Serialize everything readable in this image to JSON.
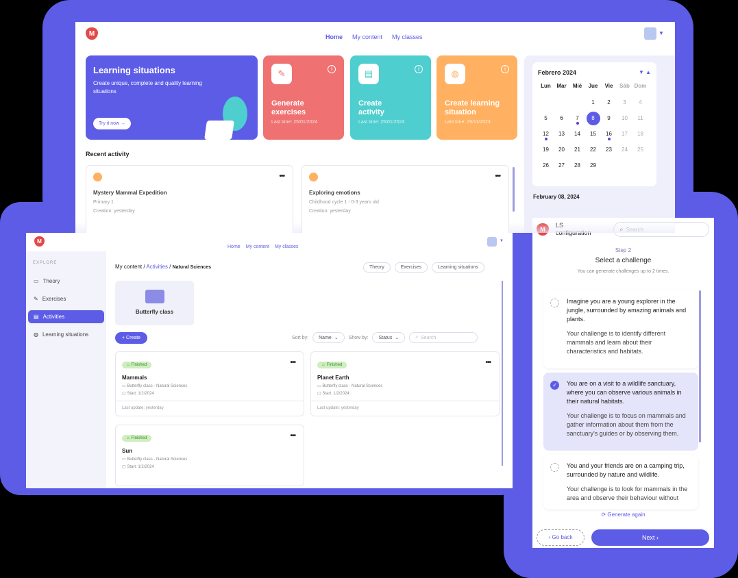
{
  "colors": {
    "accent": "#5d5ce6",
    "red": "#ef7171",
    "teal": "#4ecece",
    "orange": "#ffb060",
    "finished": "#cfeec0"
  },
  "home": {
    "nav": [
      "Home",
      "My content",
      "My classes"
    ],
    "hero": {
      "title": "Learning situations",
      "subtitle": "Create unique, complete and quality learning situations",
      "button": "Try it now"
    },
    "cards": [
      {
        "title": "Generate exercises",
        "sub": "Last time: 25/01/2024",
        "icon": "exercises-icon"
      },
      {
        "title": "Create activity",
        "sub": "Last time: 25/01/2024",
        "icon": "activity-icon"
      },
      {
        "title": "Create learning situation",
        "sub": "Last time: 29/11/2023",
        "icon": "apple-icon"
      }
    ],
    "recent_title": "Recent activity",
    "recent": [
      {
        "title": "Mystery Mammal Expedition",
        "level": "Primary 1",
        "created": "Creation: yesterday"
      },
      {
        "title": "Exploring emotions",
        "level": "Childhood cycle 1 - 0-3 years old",
        "created": "Creation: yesterday"
      }
    ],
    "calendar": {
      "month": "Febrero 2024",
      "days": [
        "Lun",
        "Mar",
        "Mié",
        "Jue",
        "Vie",
        "Sáb",
        "Dom"
      ],
      "weeks": [
        [
          "",
          "",
          "",
          "1",
          "2",
          "3",
          "4"
        ],
        [
          "5",
          "6",
          "7",
          "8",
          "9",
          "10",
          "11"
        ],
        [
          "12",
          "13",
          "14",
          "15",
          "16",
          "17",
          "18"
        ],
        [
          "19",
          "20",
          "21",
          "22",
          "23",
          "24",
          "25"
        ],
        [
          "26",
          "27",
          "28",
          "29",
          "",
          "",
          ""
        ]
      ],
      "selected": "8",
      "events": [
        "7",
        "12",
        "16"
      ],
      "selected_label": "February 08, 2024"
    }
  },
  "content": {
    "nav": [
      "Home",
      "My content",
      "My classes"
    ],
    "sidebar": {
      "heading": "EXPLORE",
      "items": [
        "Theory",
        "Exercises",
        "Activities",
        "Learning situations"
      ],
      "active": 2
    },
    "breadcrumb": [
      "My content",
      "Activities",
      "Natural Sciences"
    ],
    "filters": [
      "Theory",
      "Exercises",
      "Learning situations"
    ],
    "folder": "Butterfly class",
    "create": "Create",
    "sort_label": "Sort by:",
    "sort_value": "Name",
    "show_label": "Show by:",
    "show_value": "Status",
    "search_placeholder": "Search",
    "activities": [
      {
        "status": "Finished",
        "title": "Mammals",
        "class": "Butterfly class - Natural Sciences",
        "start": "Start: 1/2/2024",
        "updated": "Last update: yesterday"
      },
      {
        "status": "Finished",
        "title": "Planet Earth",
        "class": "Butterfly class - Natural Sciences",
        "start": "Start: 1/2/2024",
        "updated": "Last update: yesterday"
      },
      {
        "status": "Finished",
        "title": "Sun",
        "class": "Butterfly class - Natural Sciences",
        "start": "Start: 1/2/2024"
      }
    ]
  },
  "ls": {
    "title": "LS configuration",
    "search_placeholder": "Search",
    "step": "Step 2",
    "heading": "Select a challenge",
    "note": "You can generate challenges up to 2 times.",
    "options": [
      {
        "text": "Imagine you are a young explorer in the jungle, surrounded by amazing animals and plants.",
        "challenge": "Your challenge is to identify different mammals and learn about their characteristics and habitats.",
        "selected": false
      },
      {
        "text": "You are on a visit to a wildlife sanctuary, where you can observe various animals in their natural habitats.",
        "challenge": "Your challenge is to focus on mammals and gather information about them from the sanctuary's guides or by observing them.",
        "selected": true
      },
      {
        "text": "You and your friends are on a camping trip, surrounded by nature and wildlife.",
        "challenge": "Your challenge is to look for mammals in the area and observe their behaviour without",
        "selected": false
      }
    ],
    "generate": "Generate again",
    "back": "Go back",
    "next": "Next"
  }
}
